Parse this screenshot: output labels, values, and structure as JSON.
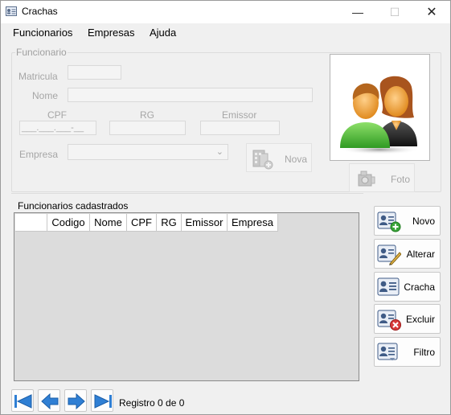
{
  "window": {
    "title": "Crachas",
    "min_glyph": "—",
    "max_glyph": "☐",
    "close_glyph": "✕"
  },
  "menu": [
    "Funcionarios",
    "Empresas",
    "Ajuda"
  ],
  "funcionario_group": {
    "legend": "Funcionario",
    "matricula_label": "Matricula",
    "matricula_value": "",
    "nome_label": "Nome",
    "nome_value": "",
    "cpf_label": "CPF",
    "cpf_value": "___.___.___-__",
    "rg_label": "RG",
    "rg_value": "",
    "emissor_label": "Emissor",
    "emissor_value": "",
    "empresa_label": "Empresa",
    "empresa_value": "",
    "nova_button": "Nova",
    "foto_button": "Foto"
  },
  "grid": {
    "label": "Funcionarios cadastrados",
    "columns": [
      "",
      "Codigo",
      "Nome",
      "CPF",
      "RG",
      "Emissor",
      "Empresa"
    ],
    "rows": []
  },
  "actions": {
    "novo": "Novo",
    "alterar": "Alterar",
    "cracha": "Cracha",
    "excluir": "Excluir",
    "filtro": "Filtro"
  },
  "navigation": {
    "status": "Registro 0 de 0"
  },
  "colors": {
    "nav_arrow": "#2f7fd4",
    "novo_accent": "#3aa53a",
    "excluir_accent": "#d93a3a"
  }
}
